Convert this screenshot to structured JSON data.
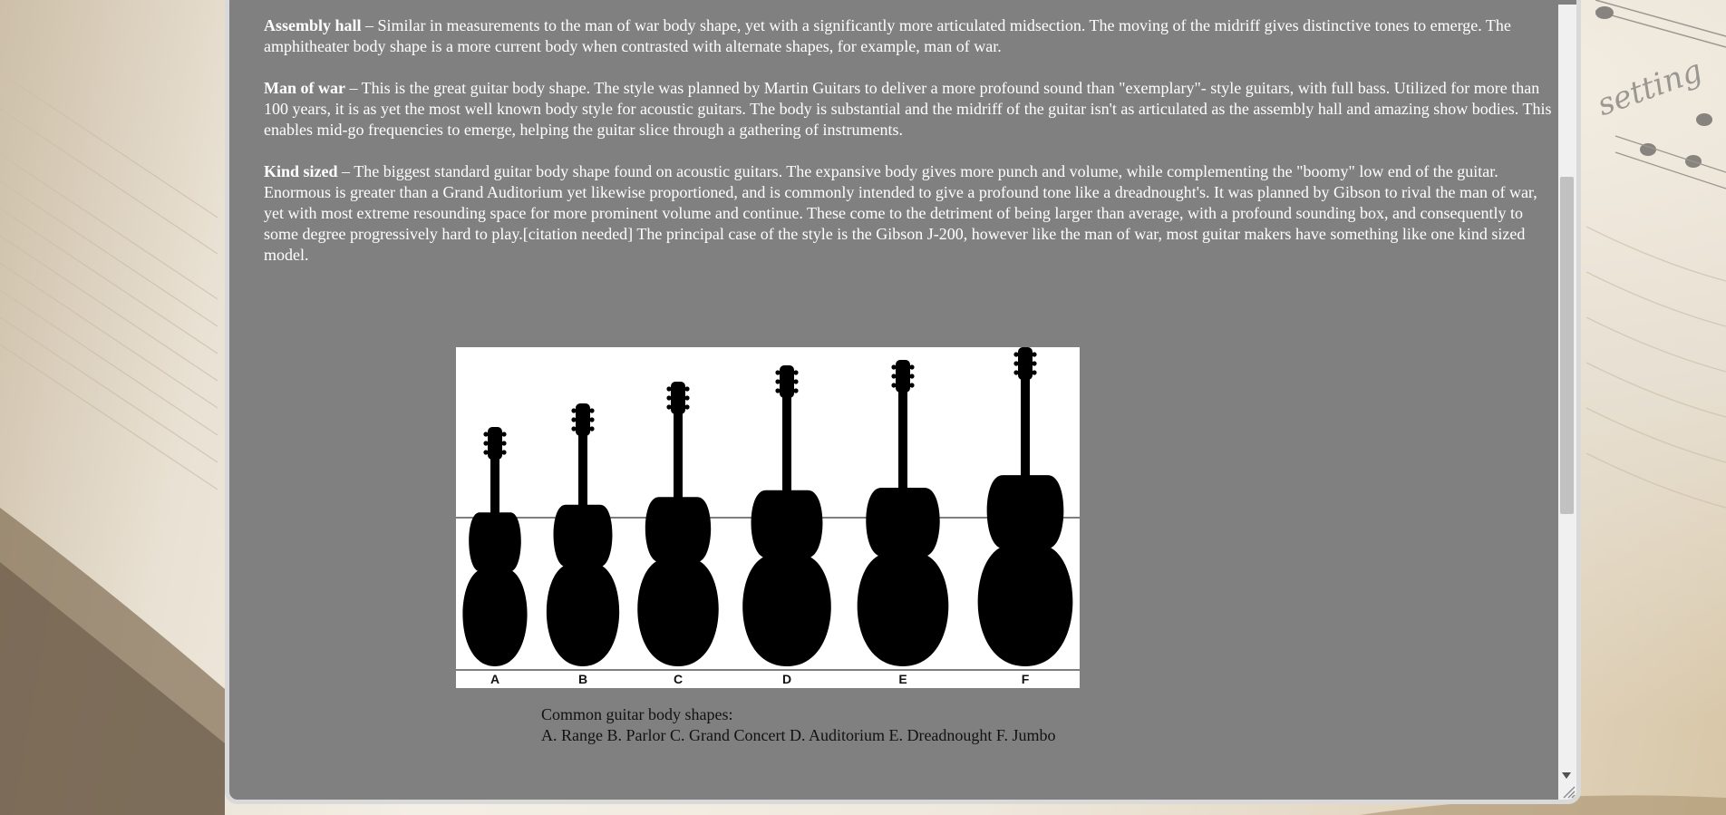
{
  "paragraphs": [
    {
      "term": "Assembly hall",
      "text": " – Similar in measurements to the man of war body shape, yet with a significantly more articulated midsection. The moving of the midriff gives distinctive tones to emerge. The amphitheater body shape is a more current body when contrasted with alternate shapes, for example, man of war."
    },
    {
      "term": "Man of war",
      "text": " – This is the great guitar body shape. The style was planned by Martin Guitars to deliver a more profound sound than \"exemplary\"- style guitars, with full bass. Utilized for more than 100 years, it is as yet the most well known body style for acoustic guitars. The body is substantial and the midriff of the guitar isn't as articulated as the assembly hall and amazing show bodies. This enables mid-go frequencies to emerge, helping the guitar slice through a gathering of instruments."
    },
    {
      "term": "Kind sized",
      "text": " – The biggest standard guitar body shape found on acoustic guitars. The expansive body gives more punch and volume, while complementing the \"boomy\" low end of the guitar. Enormous is greater than a Grand Auditorium yet likewise proportioned, and is commonly intended to give a profound tone like a dreadnought's. It was planned by Gibson to rival the man of war, yet with most extreme resounding space for more prominent volume and continue. These come to the detriment of being larger than average, with a profound sounding box, and consequently to some degree progressively hard to play.[citation needed] The principal case of the style is the Gibson J-200, however like the man of war, most guitar makers have something like one kind sized model."
    }
  ],
  "figure": {
    "letters": [
      "A",
      "B",
      "C",
      "D",
      "E",
      "F"
    ],
    "caption_line1": "Common guitar body shapes:",
    "caption_line2": "A. Range B. Parlor C. Grand Concert D. Auditorium E. Dreadnought F. Jumbo"
  },
  "colors": {
    "window_bg": "#808080",
    "text": "#ffffff",
    "caption_text": "#111111"
  }
}
